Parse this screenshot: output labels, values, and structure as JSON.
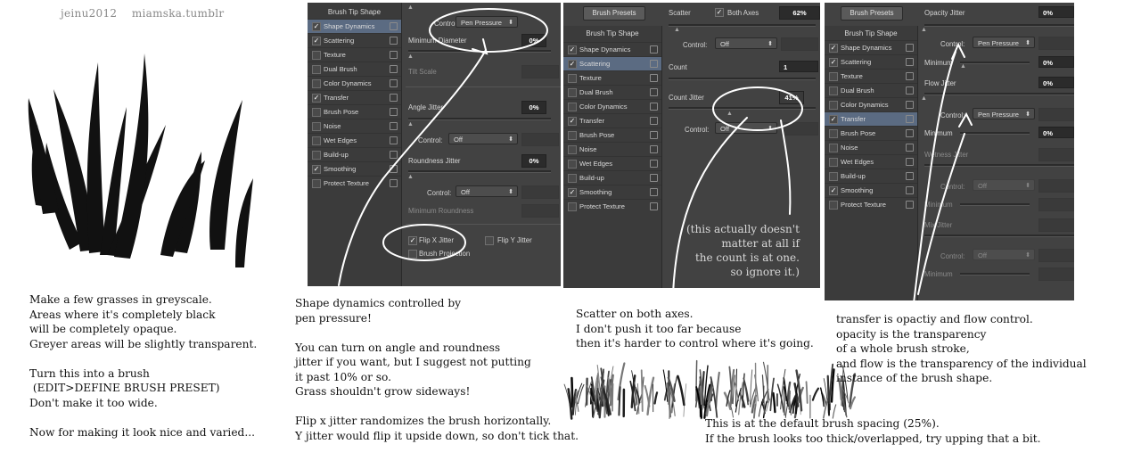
{
  "credit": {
    "author": "jeinu2012",
    "site": "miamska.tumblr"
  },
  "notes": {
    "grass": "Make a few grasses in greyscale.\nAreas where it's completely black\nwill be completely opaque.\nGreyer areas will be slightly transparent.\n\nTurn this into a brush\n (EDIT>DEFINE BRUSH PRESET)\nDon't make it too wide.\n\nNow for making it look nice and varied...",
    "shape": "Shape dynamics controlled by\npen pressure!\n\nYou can turn on angle and roundness\njitter if you want, but I suggest not putting\nit past 10% or so.\nGrass shouldn't grow sideways!\n\nFlip x jitter randomizes the brush horizontally.\nY jitter would flip it upside down, so don't tick that.",
    "scatter": "Scatter on both axes.\nI don't push it too far because\nthen it's harder to control where it's going.",
    "transfer": "transfer is opactiy and flow control.\nopacity is the transparency\nof a whole brush stroke,\nand flow is the transparency of the individual\ninstance of the brush shape.",
    "spacing": "This is at the default brush spacing (25%).\nIf the brush looks too thick/overlapped, try upping that a bit.",
    "count_aside": "(this actually doesn't\nmatter at all if\nthe count is at one.\nso ignore it.)"
  },
  "panel1": {
    "header": "Brush Tip Shape",
    "items": [
      {
        "label": "Shape Dynamics",
        "checked": "✓",
        "selected": true
      },
      {
        "label": "Scattering",
        "checked": "✓"
      },
      {
        "label": "Texture",
        "checked": ""
      },
      {
        "label": "Dual Brush",
        "checked": ""
      },
      {
        "label": "Color Dynamics",
        "checked": ""
      },
      {
        "label": "Transfer",
        "checked": "✓"
      },
      {
        "label": "Brush Pose",
        "checked": ""
      },
      {
        "label": "Noise",
        "checked": ""
      },
      {
        "label": "Wet Edges",
        "checked": ""
      },
      {
        "label": "Build-up",
        "checked": ""
      },
      {
        "label": "Smoothing",
        "checked": "✓"
      },
      {
        "label": "Protect Texture",
        "checked": ""
      }
    ],
    "control_label": "Control:",
    "control_value": "Pen Pressure",
    "min_diameter_label": "Minimum Diameter",
    "min_diameter_value": "0%",
    "tilt_scale_label": "Tilt Scale",
    "angle_jitter_label": "Angle Jitter",
    "angle_jitter_value": "0%",
    "control2_label": "Control:",
    "control2_value": "Off",
    "roundness_jitter_label": "Roundness Jitter",
    "roundness_jitter_value": "0%",
    "control3_label": "Control:",
    "control3_value": "Off",
    "min_roundness_label": "Minimum Roundness",
    "flip_x_label": "Flip X Jitter",
    "flip_y_label": "Flip Y Jitter",
    "brush_projection_label": "Brush Projection",
    "check": "✓"
  },
  "panel2": {
    "presets_button": "Brush Presets",
    "header": "Brush Tip Shape",
    "items": [
      {
        "label": "Shape Dynamics",
        "checked": "✓"
      },
      {
        "label": "Scattering",
        "checked": "✓",
        "selected": true
      },
      {
        "label": "Texture",
        "checked": ""
      },
      {
        "label": "Dual Brush",
        "checked": ""
      },
      {
        "label": "Color Dynamics",
        "checked": ""
      },
      {
        "label": "Transfer",
        "checked": "✓"
      },
      {
        "label": "Brush Pose",
        "checked": ""
      },
      {
        "label": "Noise",
        "checked": ""
      },
      {
        "label": "Wet Edges",
        "checked": ""
      },
      {
        "label": "Build-up",
        "checked": ""
      },
      {
        "label": "Smoothing",
        "checked": "✓"
      },
      {
        "label": "Protect Texture",
        "checked": ""
      }
    ],
    "scatter_label": "Scatter",
    "both_axes_label": "Both Axes",
    "scatter_value": "62%",
    "control_label": "Control:",
    "control_value": "Off",
    "count_label": "Count",
    "count_value": "1",
    "count_jitter_label": "Count Jitter",
    "count_jitter_value": "41%",
    "control2_label": "Control:",
    "control2_value": "Off",
    "check": "✓"
  },
  "panel3": {
    "presets_button": "Brush Presets",
    "header": "Brush Tip Shape",
    "items": [
      {
        "label": "Shape Dynamics",
        "checked": "✓"
      },
      {
        "label": "Scattering",
        "checked": "✓"
      },
      {
        "label": "Texture",
        "checked": ""
      },
      {
        "label": "Dual Brush",
        "checked": ""
      },
      {
        "label": "Color Dynamics",
        "checked": ""
      },
      {
        "label": "Transfer",
        "checked": "✓",
        "selected": true
      },
      {
        "label": "Brush Pose",
        "checked": ""
      },
      {
        "label": "Noise",
        "checked": ""
      },
      {
        "label": "Wet Edges",
        "checked": ""
      },
      {
        "label": "Build-up",
        "checked": ""
      },
      {
        "label": "Smoothing",
        "checked": "✓"
      },
      {
        "label": "Protect Texture",
        "checked": ""
      }
    ],
    "opacity_jitter_label": "Opacity Jitter",
    "opacity_jitter_value": "0%",
    "control_label": "Control:",
    "control_value": "Pen Pressure",
    "minimum_label": "Minimum",
    "minimum_value": "0%",
    "flow_jitter_label": "Flow Jitter",
    "flow_jitter_value": "0%",
    "control2_label": "Control:",
    "control2_value": "Pen Pressure",
    "minimum2_label": "Minimum",
    "minimum2_value": "0%",
    "wetness_jitter_label": "Wetness Jitter",
    "control3_label": "Control:",
    "control3_value": "Off",
    "minimum3_label": "Minimum",
    "mix_jitter_label": "Mix Jitter",
    "control4_label": "Control:",
    "control4_value": "Off",
    "minimum4_label": "Minimum",
    "check": "✓"
  },
  "colors": {
    "panel_bg": "#424242",
    "sidebar_bg": "#3b3b3b",
    "selection": "#5b6b82",
    "ink": "#ffffff"
  }
}
